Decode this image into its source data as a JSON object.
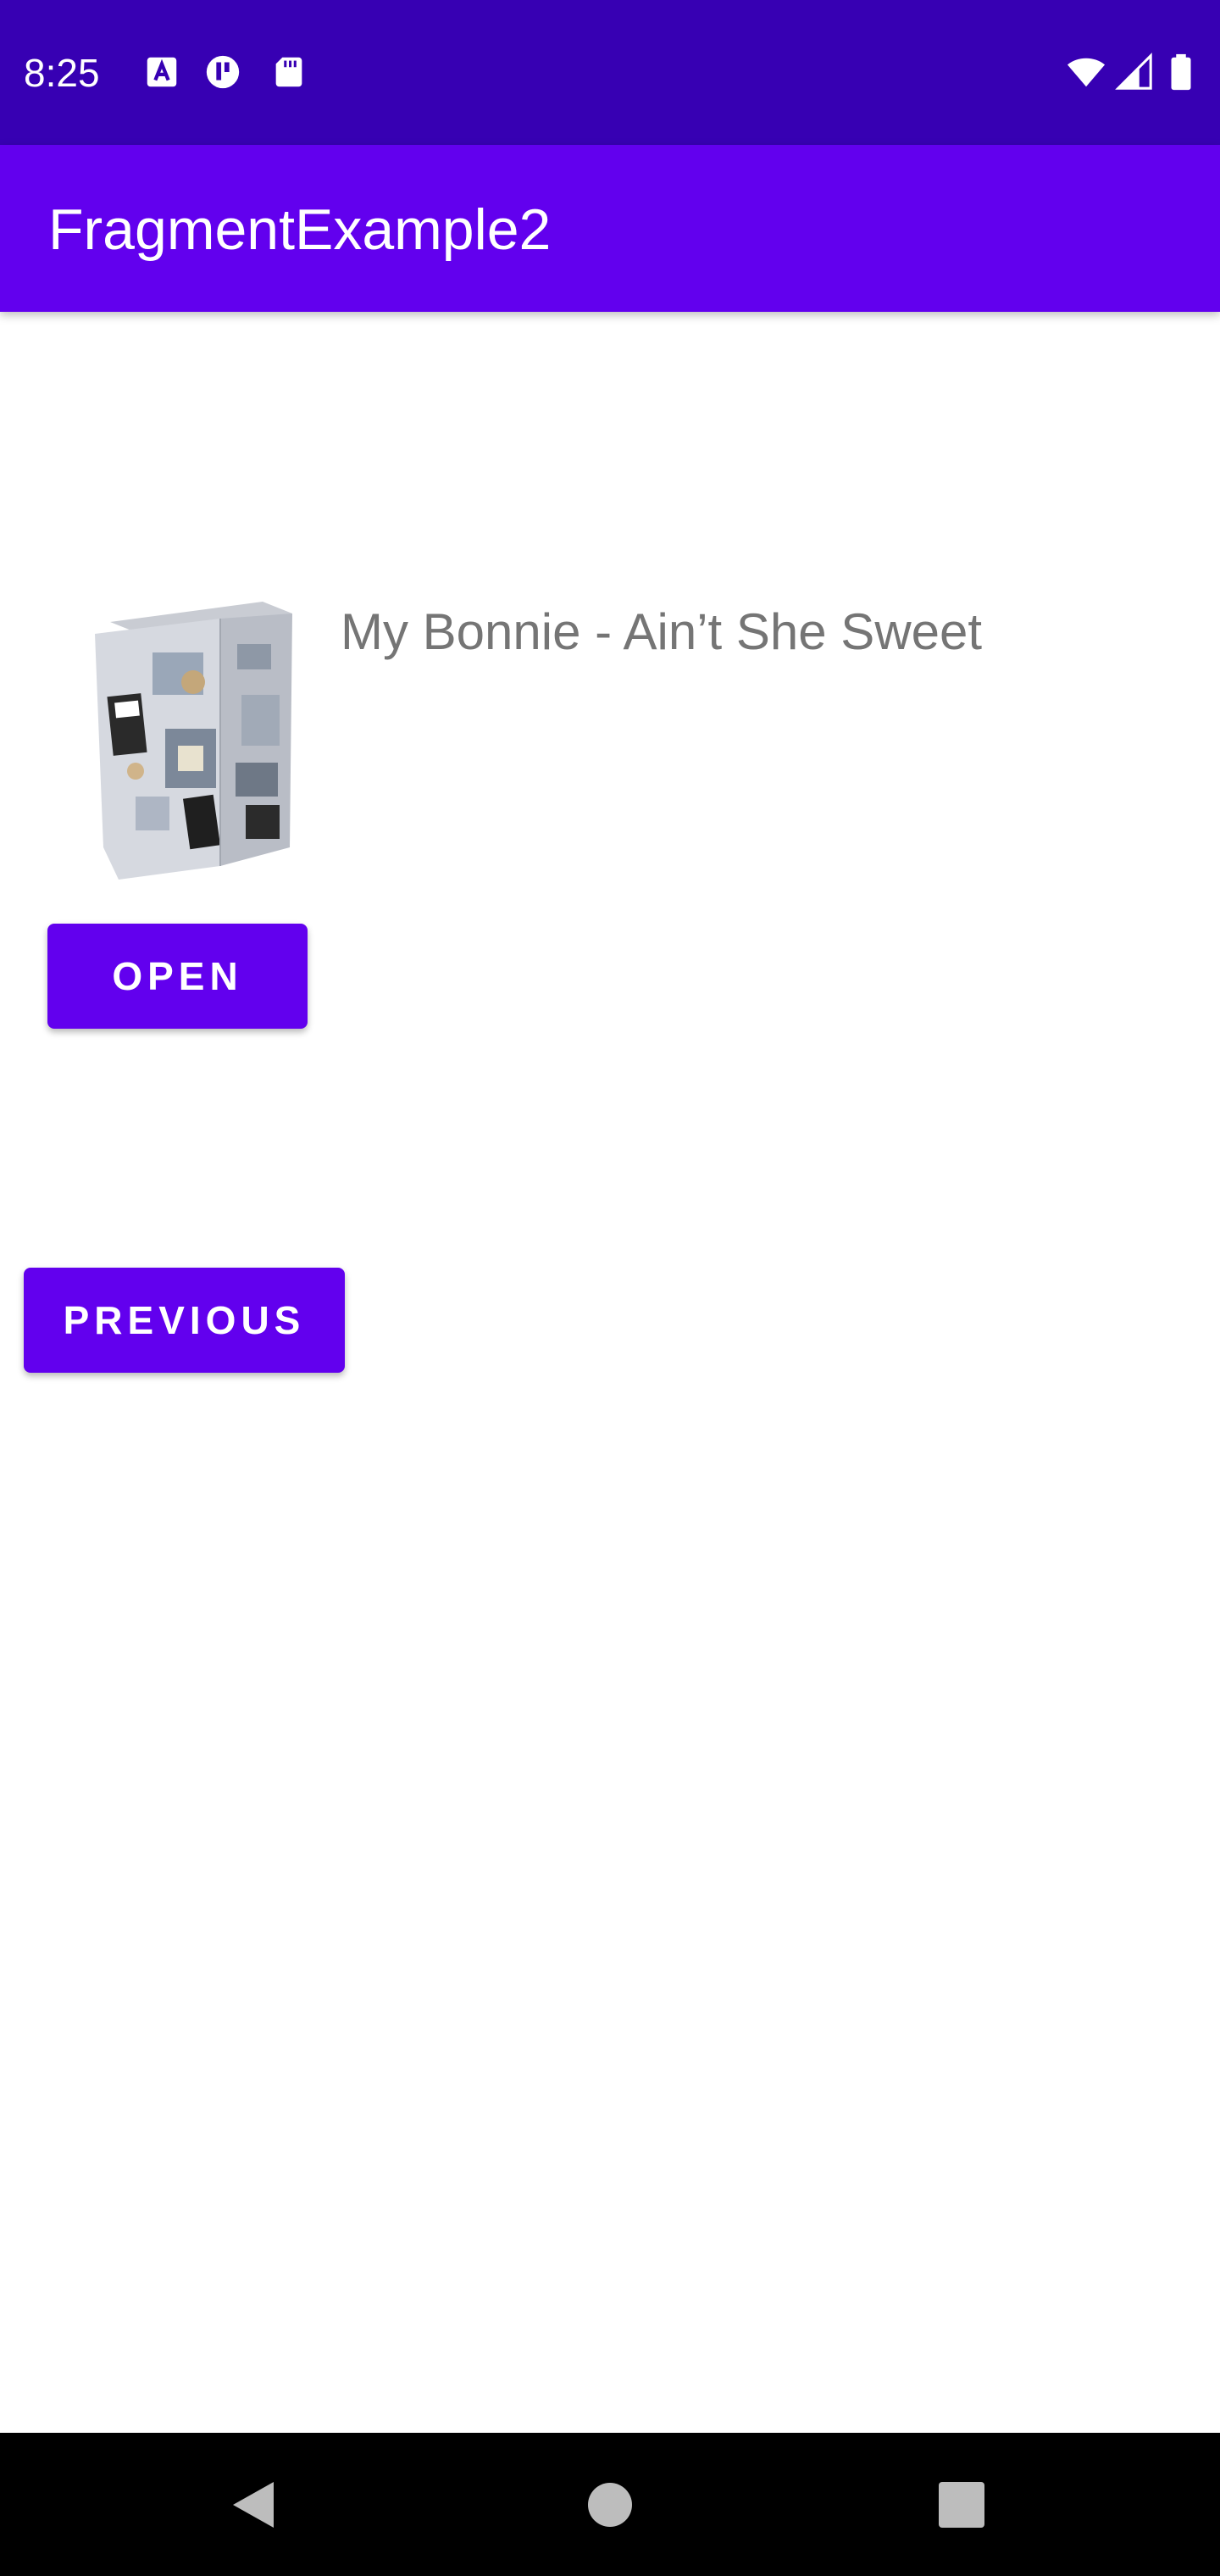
{
  "status_bar": {
    "time": "8:25",
    "icons": [
      "a-notification-icon",
      "chart-notification-icon",
      "sd-card-icon",
      "wifi-icon",
      "cell-signal-icon",
      "battery-icon"
    ],
    "background": "#3700b3"
  },
  "app_bar": {
    "title": "FragmentExample2",
    "background": "#6200ee"
  },
  "content": {
    "image_icon": "album-box-image",
    "song_title": "My Bonnie - Ain’t She Sweet",
    "open_button_label": "OPEN",
    "previous_button_label": "PREVIOUS",
    "accent_color": "#6200ee",
    "text_color": "#757575"
  },
  "nav_bar": {
    "icons": [
      "back-icon",
      "home-icon",
      "recents-icon"
    ],
    "background": "#000000"
  }
}
